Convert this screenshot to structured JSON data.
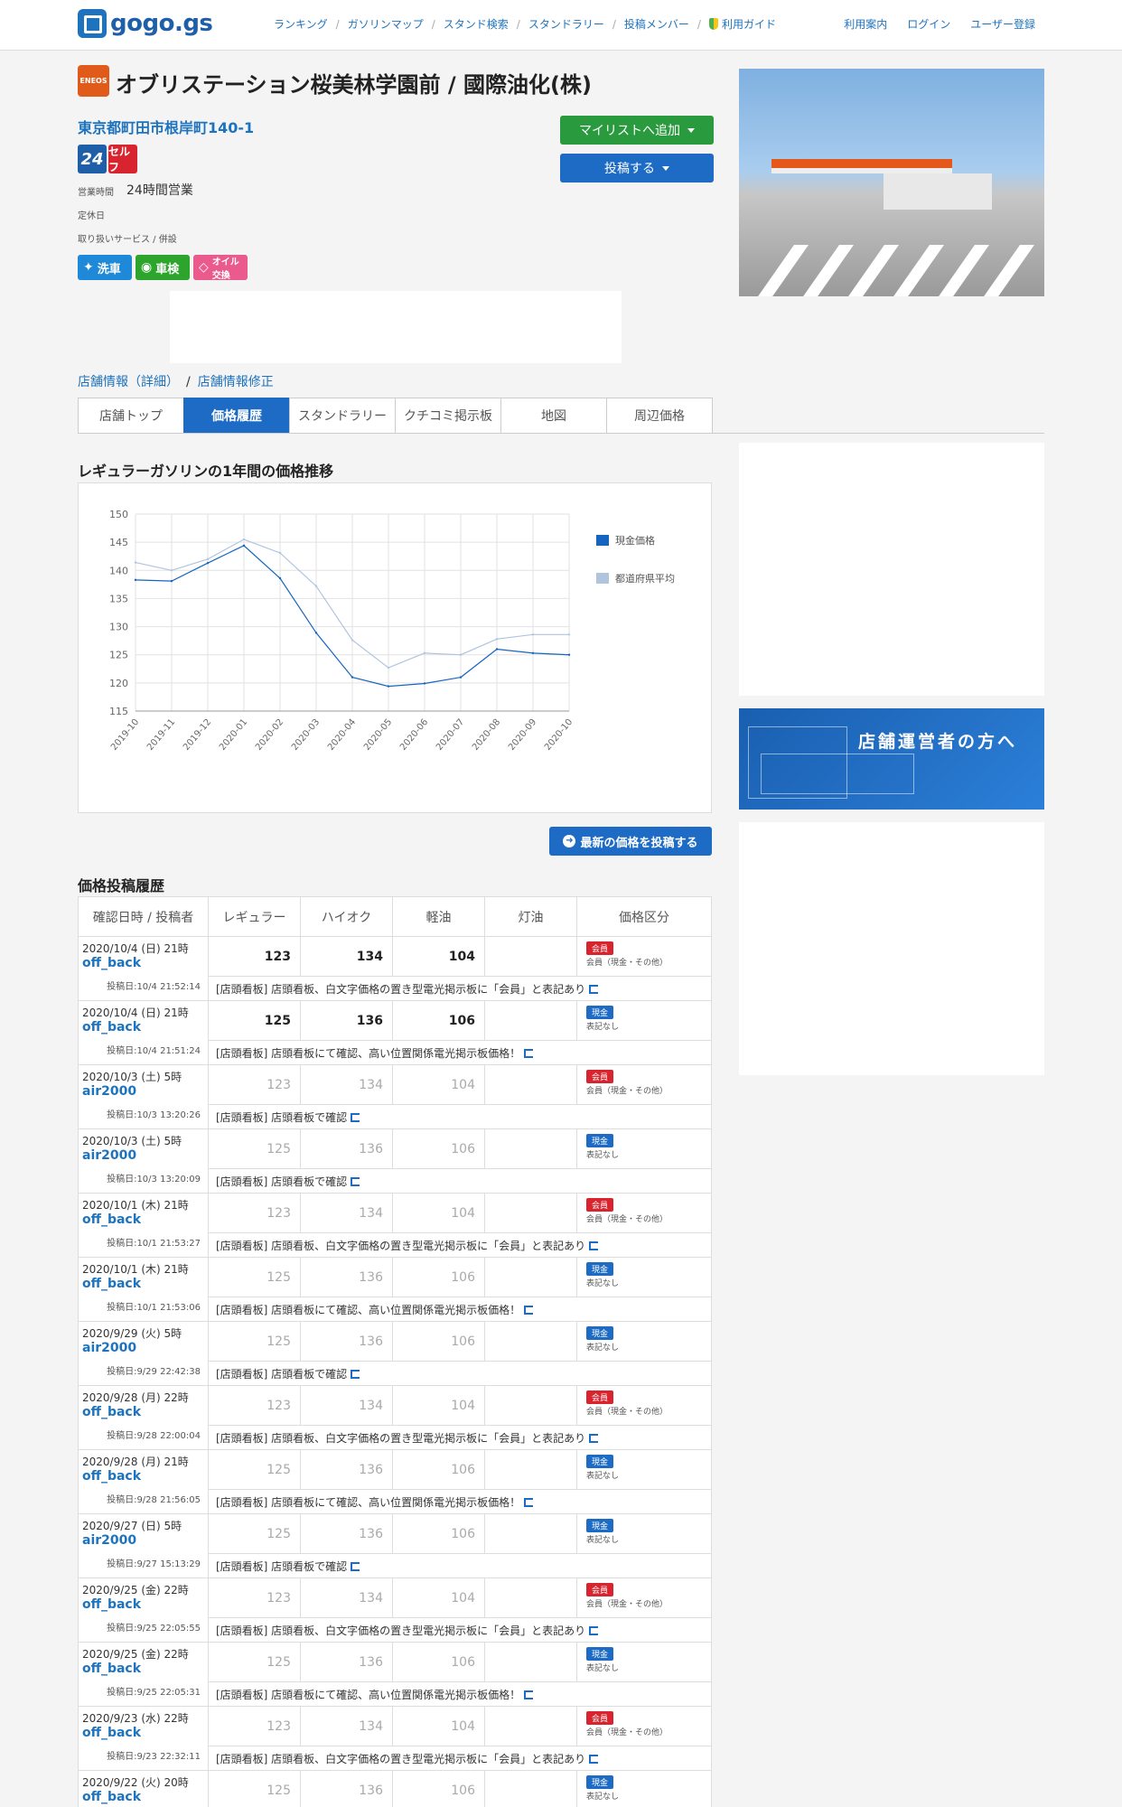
{
  "header": {
    "logo_text": "gogo.gs",
    "nav": [
      "ランキング",
      "ガソリンマップ",
      "スタンド検索",
      "スタンドラリー",
      "投稿メンバー",
      "利用ガイド"
    ],
    "nav_right": [
      "利用案内",
      "ログイン",
      "ユーザー登録"
    ]
  },
  "station": {
    "brand": "ENEOS",
    "title": "オブリステーション桜美林学園前 / 國際油化(株)",
    "address": "東京都町田市根岸町140-1",
    "badge_24": "24",
    "badge_self": "セルフ",
    "hours_label": "営業時間",
    "hours_value": "24時間営業",
    "closed_label": "定休日",
    "service_label": "取り扱いサービス / 併設",
    "services": [
      "洗車",
      "車検",
      "オイル交換"
    ],
    "mylist_button": "マイリストへ追加",
    "post_button": "投稿する"
  },
  "breadcrumb": [
    "店舗情報（詳細）",
    "店舗情報修正"
  ],
  "tabs": [
    "店舗トップ",
    "価格履歴",
    "スタンドラリー",
    "クチコミ掲示板",
    "地図",
    "周辺価格"
  ],
  "active_tab": 1,
  "chart_title": "レギュラーガソリンの1年間の価格推移",
  "chart_data": {
    "type": "line",
    "categories": [
      "2019-10",
      "2019-11",
      "2019-12",
      "2020-01",
      "2020-02",
      "2020-03",
      "2020-04",
      "2020-05",
      "2020-06",
      "2020-07",
      "2020-08",
      "2020-09",
      "2020-10"
    ],
    "series": [
      {
        "name": "現金価格",
        "color": "#1565c0",
        "values": [
          138.3,
          138.1,
          141.3,
          144.4,
          138.6,
          128.9,
          121.0,
          119.4,
          119.9,
          121.0,
          126.0,
          125.3,
          125.0
        ]
      },
      {
        "name": "都道府県平均",
        "color": "#b0c4de",
        "values": [
          141.4,
          140.0,
          142.0,
          145.5,
          143.1,
          137.2,
          127.6,
          122.7,
          125.3,
          125.0,
          127.8,
          128.6,
          128.6
        ]
      }
    ],
    "ylim": [
      115,
      150
    ],
    "yticks": [
      115,
      120,
      125,
      130,
      135,
      140,
      145,
      150
    ],
    "grid": true,
    "legend": "right"
  },
  "latest_button": "最新の価格を投稿する",
  "history_title": "価格投稿履歴",
  "table": {
    "headers": [
      "確認日時 / 投稿者",
      "レギュラー",
      "ハイオク",
      "軽油",
      "灯油",
      "価格区分"
    ],
    "rows": [
      {
        "date": "2020/10/4 (日) 21時",
        "user": "off_back",
        "regular": "123",
        "high": "134",
        "diesel": "104",
        "kerosene": "",
        "type": "会員",
        "type_sub": "会員（現金・その他）",
        "posted": "投稿日:10/4 21:52:14",
        "note": "[店頭看板] 店頭看板、白文字価格の置き型電光掲示板に「会員」と表記あり",
        "style": "dark"
      },
      {
        "date": "2020/10/4 (日) 21時",
        "user": "off_back",
        "regular": "125",
        "high": "136",
        "diesel": "106",
        "kerosene": "",
        "type": "現金",
        "type_sub": "表記なし",
        "posted": "投稿日:10/4 21:51:24",
        "note": "[店頭看板] 店頭看板にて確認、高い位置関係電光掲示板価格！",
        "style": "dark"
      },
      {
        "date": "2020/10/3 (土) 5時",
        "user": "air2000",
        "regular": "123",
        "high": "134",
        "diesel": "104",
        "kerosene": "",
        "type": "会員",
        "type_sub": "会員（現金・その他）",
        "posted": "投稿日:10/3 13:20:26",
        "note": "[店頭看板] 店頭看板で確認",
        "style": "muted"
      },
      {
        "date": "2020/10/3 (土) 5時",
        "user": "air2000",
        "regular": "125",
        "high": "136",
        "diesel": "106",
        "kerosene": "",
        "type": "現金",
        "type_sub": "表記なし",
        "posted": "投稿日:10/3 13:20:09",
        "note": "[店頭看板] 店頭看板で確認",
        "style": "muted"
      },
      {
        "date": "2020/10/1 (木) 21時",
        "user": "off_back",
        "regular": "123",
        "high": "134",
        "diesel": "104",
        "kerosene": "",
        "type": "会員",
        "type_sub": "会員（現金・その他）",
        "posted": "投稿日:10/1 21:53:27",
        "note": "[店頭看板] 店頭看板、白文字価格の置き型電光掲示板に「会員」と表記あり",
        "style": "muted"
      },
      {
        "date": "2020/10/1 (木) 21時",
        "user": "off_back",
        "regular": "125",
        "high": "136",
        "diesel": "106",
        "kerosene": "",
        "type": "現金",
        "type_sub": "表記なし",
        "posted": "投稿日:10/1 21:53:06",
        "note": "[店頭看板] 店頭看板にて確認、高い位置関係電光掲示板価格！",
        "style": "muted"
      },
      {
        "date": "2020/9/29 (火) 5時",
        "user": "air2000",
        "regular": "125",
        "high": "136",
        "diesel": "106",
        "kerosene": "",
        "type": "現金",
        "type_sub": "表記なし",
        "posted": "投稿日:9/29 22:42:38",
        "note": "[店頭看板] 店頭看板で確認",
        "style": "muted"
      },
      {
        "date": "2020/9/28 (月) 22時",
        "user": "off_back",
        "regular": "123",
        "high": "134",
        "diesel": "104",
        "kerosene": "",
        "type": "会員",
        "type_sub": "会員（現金・その他）",
        "posted": "投稿日:9/28 22:00:04",
        "note": "[店頭看板] 店頭看板、白文字価格の置き型電光掲示板に「会員」と表記あり",
        "style": "muted"
      },
      {
        "date": "2020/9/28 (月) 21時",
        "user": "off_back",
        "regular": "125",
        "high": "136",
        "diesel": "106",
        "kerosene": "",
        "type": "現金",
        "type_sub": "表記なし",
        "posted": "投稿日:9/28 21:56:05",
        "note": "[店頭看板] 店頭看板にて確認、高い位置関係電光掲示板価格！",
        "style": "muted"
      },
      {
        "date": "2020/9/27 (日) 5時",
        "user": "air2000",
        "regular": "125",
        "high": "136",
        "diesel": "106",
        "kerosene": "",
        "type": "現金",
        "type_sub": "表記なし",
        "posted": "投稿日:9/27 15:13:29",
        "note": "[店頭看板] 店頭看板で確認",
        "style": "muted"
      },
      {
        "date": "2020/9/25 (金) 22時",
        "user": "off_back",
        "regular": "123",
        "high": "134",
        "diesel": "104",
        "kerosene": "",
        "type": "会員",
        "type_sub": "会員（現金・その他）",
        "posted": "投稿日:9/25 22:05:55",
        "note": "[店頭看板] 店頭看板、白文字価格の置き型電光掲示板に「会員」と表記あり",
        "style": "muted"
      },
      {
        "date": "2020/9/25 (金) 22時",
        "user": "off_back",
        "regular": "125",
        "high": "136",
        "diesel": "106",
        "kerosene": "",
        "type": "現金",
        "type_sub": "表記なし",
        "posted": "投稿日:9/25 22:05:31",
        "note": "[店頭看板] 店頭看板にて確認、高い位置関係電光掲示板価格！",
        "style": "muted"
      },
      {
        "date": "2020/9/23 (水) 22時",
        "user": "off_back",
        "regular": "123",
        "high": "134",
        "diesel": "104",
        "kerosene": "",
        "type": "会員",
        "type_sub": "会員（現金・その他）",
        "posted": "投稿日:9/23 22:32:11",
        "note": "[店頭看板] 店頭看板、白文字価格の置き型電光掲示板に「会員」と表記あり",
        "style": "muted"
      },
      {
        "date": "2020/9/22 (火) 20時",
        "user": "off_back",
        "regular": "125",
        "high": "136",
        "diesel": "106",
        "kerosene": "",
        "type": "現金",
        "type_sub": "表記なし",
        "posted": "",
        "note": "",
        "style": "muted"
      }
    ]
  },
  "side_banner_text": "店舗運営者の方へ",
  "colors": {
    "accent": "#1d6bc4",
    "green": "#2a9a3e",
    "member": "#d8242e"
  }
}
